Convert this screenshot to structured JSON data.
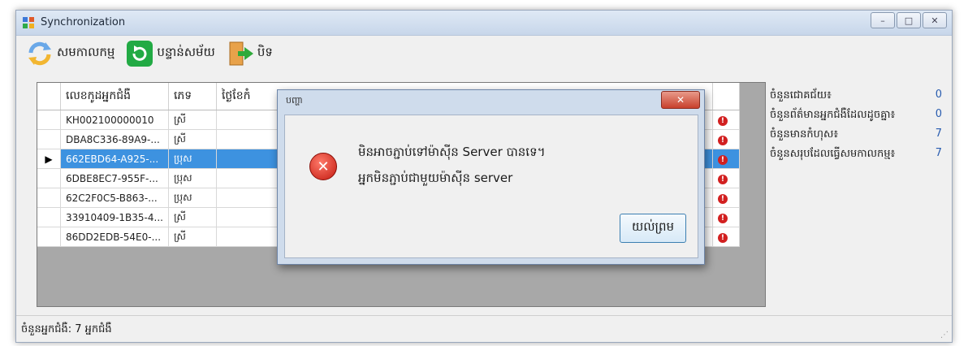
{
  "window": {
    "title": "Synchronization",
    "controls": [
      "–",
      "□",
      "✕"
    ]
  },
  "toolbar": {
    "sync_label": "សមកាលកម្ម",
    "refresh_label": "បន្ទាន់សម័យ",
    "close_label": "បិទ"
  },
  "grid": {
    "columns": [
      "លេខកូដអ្នកជំងឺ",
      "ភេទ",
      "ថ្ងៃខែកំ"
    ],
    "rows": [
      {
        "code": "KH002100000010",
        "gender": "ស្រី",
        "error": "!"
      },
      {
        "code": "DBA8C336-89A9-...",
        "gender": "ស្រី",
        "error": "!"
      },
      {
        "code": "662EBD64-A925-...",
        "gender": "ប្រុស",
        "error": "!"
      },
      {
        "code": "6DBE8EC7-955F-...",
        "gender": "ប្រុស",
        "error": "!"
      },
      {
        "code": "62C2F0C5-B863-...",
        "gender": "ប្រុស",
        "error": "!"
      },
      {
        "code": "33910409-1B35-4...",
        "gender": "ស្រី",
        "error": "!"
      },
      {
        "code": "86DD2EDB-54E0-...",
        "gender": "ស្រី",
        "error": "!"
      }
    ],
    "selected_row_marker": "▶"
  },
  "stats": [
    {
      "label": "ចំនួនជោគជ័យ៖",
      "value": "0"
    },
    {
      "label": "ចំនួនព័ត៌មានអ្នកជំងឺដែលដូចគ្នា៖",
      "value": "0"
    },
    {
      "label": "ចំនួនមានកំហុស៖",
      "value": "7"
    },
    {
      "label": "ចំនួនសរុបដែលធ្វើសមកាលកម្ម៖",
      "value": "7"
    }
  ],
  "statusbar": {
    "text": "ចំនួនអ្នកជំងឺ:  7 អ្នកជំងឺ"
  },
  "dialog": {
    "title": "បញ្ហា",
    "close": "✕",
    "message_line1": "មិនអាចភ្ជាប់ទៅម៉ាស៊ីន Server បានទេ។",
    "message_line2": "អ្នកមិនភ្ជាប់ជាមួយម៉ាស៊ីន server",
    "ok_label": "យល់ព្រម"
  },
  "colors": {
    "selection": "#3d92e0",
    "error": "#d22020",
    "stat_value": "#2a5db0"
  }
}
